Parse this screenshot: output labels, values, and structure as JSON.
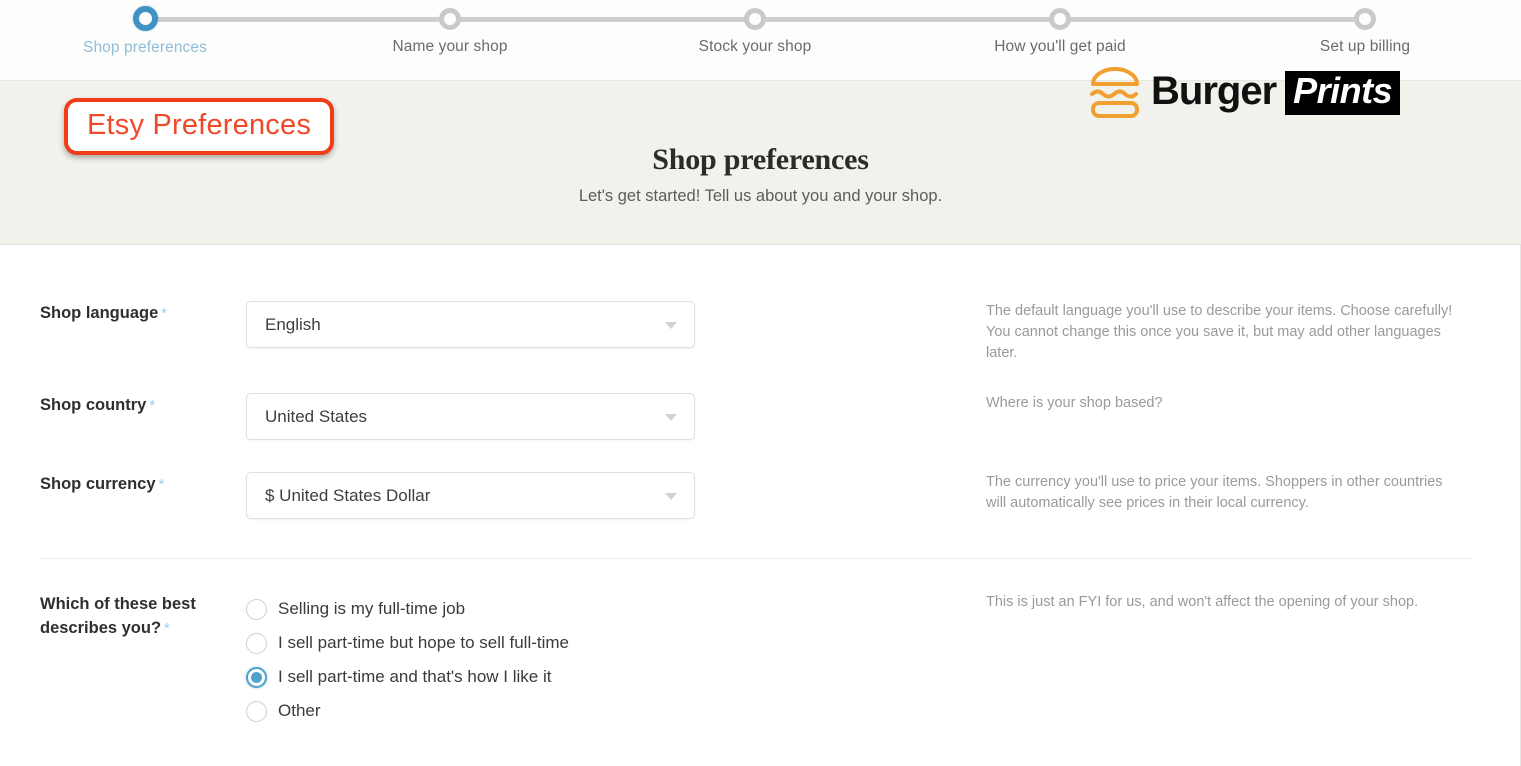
{
  "stepper": {
    "steps": [
      {
        "label": "Shop preferences",
        "active": true
      },
      {
        "label": "Name your shop",
        "active": false
      },
      {
        "label": "Stock your shop",
        "active": false
      },
      {
        "label": "How you'll get paid",
        "active": false
      },
      {
        "label": "Set up billing",
        "active": false
      }
    ],
    "active_color": "#3e93c2",
    "inactive_color": "#c9c9c9"
  },
  "logo": {
    "word": "Burger",
    "badge": "Prints",
    "icon": "burger-icon",
    "icon_color": "#f0a030",
    "badge_bg": "#000000"
  },
  "annotation": {
    "text": "Etsy Preferences",
    "border_color": "#f13c18",
    "text_color": "#f0492a"
  },
  "hero": {
    "title": "Shop preferences",
    "subtitle": "Let's get started! Tell us about you and your shop.",
    "background": "#f2f2ec"
  },
  "form": {
    "required_marker": "*",
    "fields": [
      {
        "label": "Shop language",
        "value": "English",
        "help": "The default language you'll use to describe your items. Choose carefully! You cannot change this once you save it, but may add other languages later."
      },
      {
        "label": "Shop country",
        "value": "United States",
        "help": "Where is your shop based?"
      },
      {
        "label": "Shop currency",
        "value": "$ United States Dollar",
        "help": "The currency you'll use to price your items. Shoppers in other countries will automatically see prices in their local currency."
      }
    ],
    "radio_question": {
      "label_line1": "Which of these best",
      "label_line2": "describes you?",
      "help": "This is just an FYI for us, and won't affect the opening of your shop.",
      "options": [
        {
          "label": "Selling is my full-time job",
          "selected": false
        },
        {
          "label": "I sell part-time but hope to sell full-time",
          "selected": false
        },
        {
          "label": "I sell part-time and that's how I like it",
          "selected": true
        },
        {
          "label": "Other",
          "selected": false
        }
      ],
      "selected_color": "#4ea3cd"
    }
  }
}
